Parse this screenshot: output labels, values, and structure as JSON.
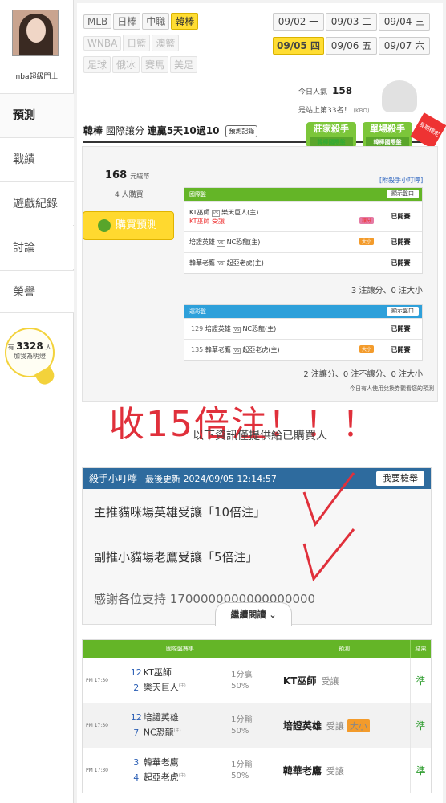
{
  "profile": {
    "name": "nba超級門士"
  },
  "sidebar": {
    "items": [
      "預測",
      "戰績",
      "遊戲紀錄",
      "討論",
      "榮譽"
    ]
  },
  "fans": {
    "prefix": "有",
    "count": "3328",
    "suffix": "人",
    "cta": "加我為明燈"
  },
  "sports": {
    "row1": [
      "MLB",
      "日棒",
      "中職",
      "韓棒"
    ],
    "row2": [
      "WNBA",
      "日籃",
      "澳籃"
    ],
    "row3": [
      "足球",
      "俄冰",
      "賽馬",
      "美足"
    ],
    "active": "韓棒"
  },
  "dates": [
    {
      "date": "09/02",
      "day": "一"
    },
    {
      "date": "09/03",
      "day": "二"
    },
    {
      "date": "09/04",
      "day": "三"
    },
    {
      "date": "09/05",
      "day": "四"
    },
    {
      "date": "09/06",
      "day": "五"
    },
    {
      "date": "09/07",
      "day": "六"
    }
  ],
  "active_date": "09/05",
  "stats": {
    "today_popularity_label": "今日人氣",
    "today_popularity": "158",
    "rank_text": "是站上第33名！",
    "rank_note": "(KBO)"
  },
  "headline": {
    "league": "韓棒",
    "market": "國際讓分",
    "streak": "連贏5天10過10",
    "record_btn": "預測記錄"
  },
  "badges": {
    "b1": "莊家殺手",
    "b1_sub": "韓棒國際盤",
    "b2": "單場殺手",
    "b2_sub": "韓棒國際盤",
    "ribbon": "長期穩定"
  },
  "purchase": {
    "price": "168",
    "price_unit": "元絨幣",
    "buyers": "4 人購買",
    "buy_button": "購買預測",
    "tip_link": "[附殺手小叮嚀]"
  },
  "intl_board": {
    "title": "國際盤",
    "show_button": "顯示盤口",
    "rows": [
      {
        "away": "KT巫師",
        "home": "樂天巨人(主)",
        "pick": "KT巫師",
        "pick_type": "受讓",
        "label": "讓分",
        "status": "已開賽"
      },
      {
        "away": "培證英雄",
        "home": "NC恐龍(主)",
        "label": "大小",
        "status": "已開賽"
      },
      {
        "away": "韓華老鷹",
        "home": "起亞老虎(主)",
        "status": "已開賽"
      }
    ],
    "summary": "3 注讓分、0 注大小"
  },
  "lottery_board": {
    "title": "運彩盤",
    "show_button": "顯示盤口",
    "rows": [
      {
        "num": "129",
        "away": "培證英雄",
        "home": "NC恐龍(主)",
        "status": "已開賽"
      },
      {
        "num": "135",
        "away": "韓華老鷹",
        "home": "起亞老虎(主)",
        "label": "大小",
        "status": "已開賽"
      }
    ],
    "summary": "2 注讓分、0 注不讓分、0 注大小"
  },
  "exchange_note": "今日有人使用兌換券觀看您的預測",
  "overlay_text": "收15倍注！！！",
  "buyers_only": "以下資訊僅提供給已購買人",
  "tips": {
    "title": "殺手小叮嚀",
    "updated": "最後更新 2024/09/05 12:14:57",
    "report": "我要檢舉",
    "line1": "主推貓咪場英雄受讓「10倍注」",
    "line2": "副推小貓場老鷹受讓「5倍注」",
    "line3": "感謝各位支持 1700000000000000000",
    "more": "繼續閱讀"
  },
  "results": {
    "header": {
      "event": "國際盤賽事",
      "prediction": "預測",
      "result": "結果"
    },
    "rows": [
      {
        "time": "PM 17:30",
        "n1": "12",
        "t1": "KT巫師",
        "n2": "2",
        "t2": "樂天巨人",
        "home": "(主)",
        "score": "1分贏",
        "pct": "50%",
        "pick": "KT巫師",
        "type": "受讓",
        "label": "",
        "result": "準"
      },
      {
        "time": "PM 17:30",
        "n1": "12",
        "t1": "培證英雄",
        "n2": "7",
        "t2": "NC恐龍",
        "home": "(主)",
        "score": "1分輸",
        "pct": "50%",
        "pick": "培證英雄",
        "type": "受讓",
        "label": "大小",
        "result": "準"
      },
      {
        "time": "PM 17:30",
        "n1": "3",
        "t1": "韓華老鷹",
        "n2": "4",
        "t2": "起亞老虎",
        "home": "(主)",
        "score": "1分輸",
        "pct": "50%",
        "pick": "韓華老鷹",
        "type": "受讓",
        "label": "",
        "result": "準"
      }
    ]
  }
}
